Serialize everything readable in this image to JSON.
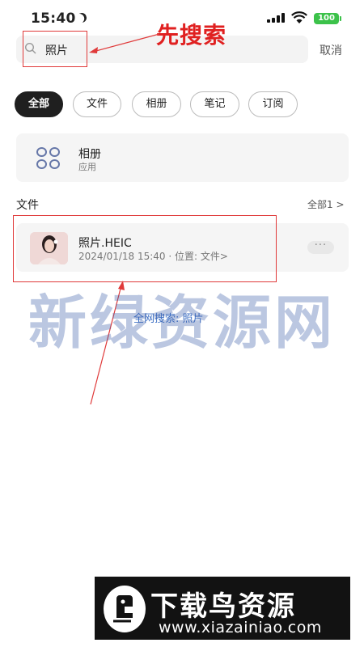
{
  "status_bar": {
    "time": "15:40",
    "battery": "100"
  },
  "search": {
    "value": "照片",
    "cancel_label": "取消"
  },
  "annotation": {
    "text": "先搜索"
  },
  "filters": [
    {
      "label": "全部",
      "active": true
    },
    {
      "label": "文件",
      "active": false
    },
    {
      "label": "相册",
      "active": false
    },
    {
      "label": "笔记",
      "active": false
    },
    {
      "label": "订阅",
      "active": false
    }
  ],
  "app_result": {
    "name": "相册",
    "subtitle": "应用"
  },
  "files_section": {
    "title": "文件",
    "more_label": "全部1 >"
  },
  "file_result": {
    "name": "照片.HEIC",
    "meta": "2024/01/18 15:40 · 位置: 文件>",
    "more_icon": "···"
  },
  "web_search": {
    "label": "全网搜索: 照片"
  },
  "watermark": {
    "text": "新绿资源网"
  },
  "banner": {
    "title": "下载鸟资源",
    "url": "www.xiazainiao.com"
  },
  "colors": {
    "annotation": "#e02020",
    "accent": "#3d6fc4",
    "battery": "#3cc24a"
  }
}
